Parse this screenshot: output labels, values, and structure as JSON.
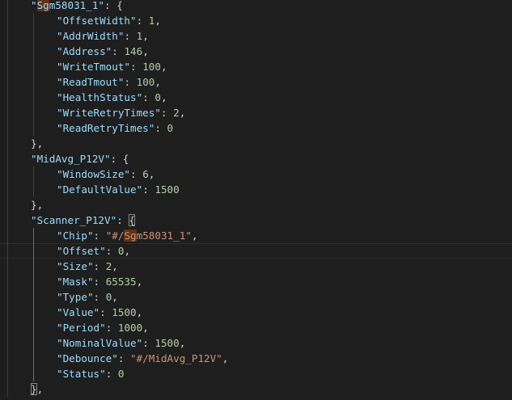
{
  "editor": {
    "lines": [
      {
        "indent": 1,
        "key": "Sgm58031_1",
        "hl_prefix": "Sg",
        "after": ": {",
        "type": "open"
      },
      {
        "indent": 2,
        "key": "OffsetWidth",
        "num": "1",
        "comma": true
      },
      {
        "indent": 2,
        "key": "AddrWidth",
        "num": "1",
        "comma": true
      },
      {
        "indent": 2,
        "key": "Address",
        "num": "146",
        "comma": true
      },
      {
        "indent": 2,
        "key": "WriteTmout",
        "num": "100",
        "comma": true
      },
      {
        "indent": 2,
        "key": "ReadTmout",
        "num": "100",
        "comma": true
      },
      {
        "indent": 2,
        "key": "HealthStatus",
        "num": "0",
        "comma": true
      },
      {
        "indent": 2,
        "key": "WriteRetryTimes",
        "num": "2",
        "comma": true
      },
      {
        "indent": 2,
        "key": "ReadRetryTimes",
        "num": "0",
        "comma": false
      },
      {
        "indent": 1,
        "close": "},"
      },
      {
        "indent": 1,
        "key": "MidAvg_P12V",
        "after": ": {",
        "type": "open"
      },
      {
        "indent": 2,
        "key": "WindowSize",
        "num": "6",
        "comma": true
      },
      {
        "indent": 2,
        "key": "DefaultValue",
        "num": "1500",
        "comma": false
      },
      {
        "indent": 1,
        "close": "},"
      },
      {
        "indent": 1,
        "key": "Scanner_P12V",
        "after": ": {",
        "type": "open",
        "bracket_match": true
      },
      {
        "indent": 2,
        "key": "Chip",
        "str_prefix": "#/",
        "str_hl": "Sg",
        "str_rest": "m58031_1",
        "comma": true
      },
      {
        "indent": 2,
        "key": "Offset",
        "num": "0",
        "comma": true,
        "current": true
      },
      {
        "indent": 2,
        "key": "Size",
        "num": "2",
        "comma": true
      },
      {
        "indent": 2,
        "key": "Mask",
        "num": "65535",
        "comma": true
      },
      {
        "indent": 2,
        "key": "Type",
        "num": "0",
        "comma": true
      },
      {
        "indent": 2,
        "key": "Value",
        "num": "1500",
        "comma": true
      },
      {
        "indent": 2,
        "key": "Period",
        "num": "1000",
        "comma": true
      },
      {
        "indent": 2,
        "key": "NominalValue",
        "num": "1500",
        "comma": true
      },
      {
        "indent": 2,
        "key": "Debounce",
        "str": "#/MidAvg_P12V",
        "comma": true
      },
      {
        "indent": 2,
        "key": "Status",
        "num": "0",
        "comma": false
      },
      {
        "indent": 1,
        "close": "},",
        "bracket_match": true
      }
    ]
  }
}
